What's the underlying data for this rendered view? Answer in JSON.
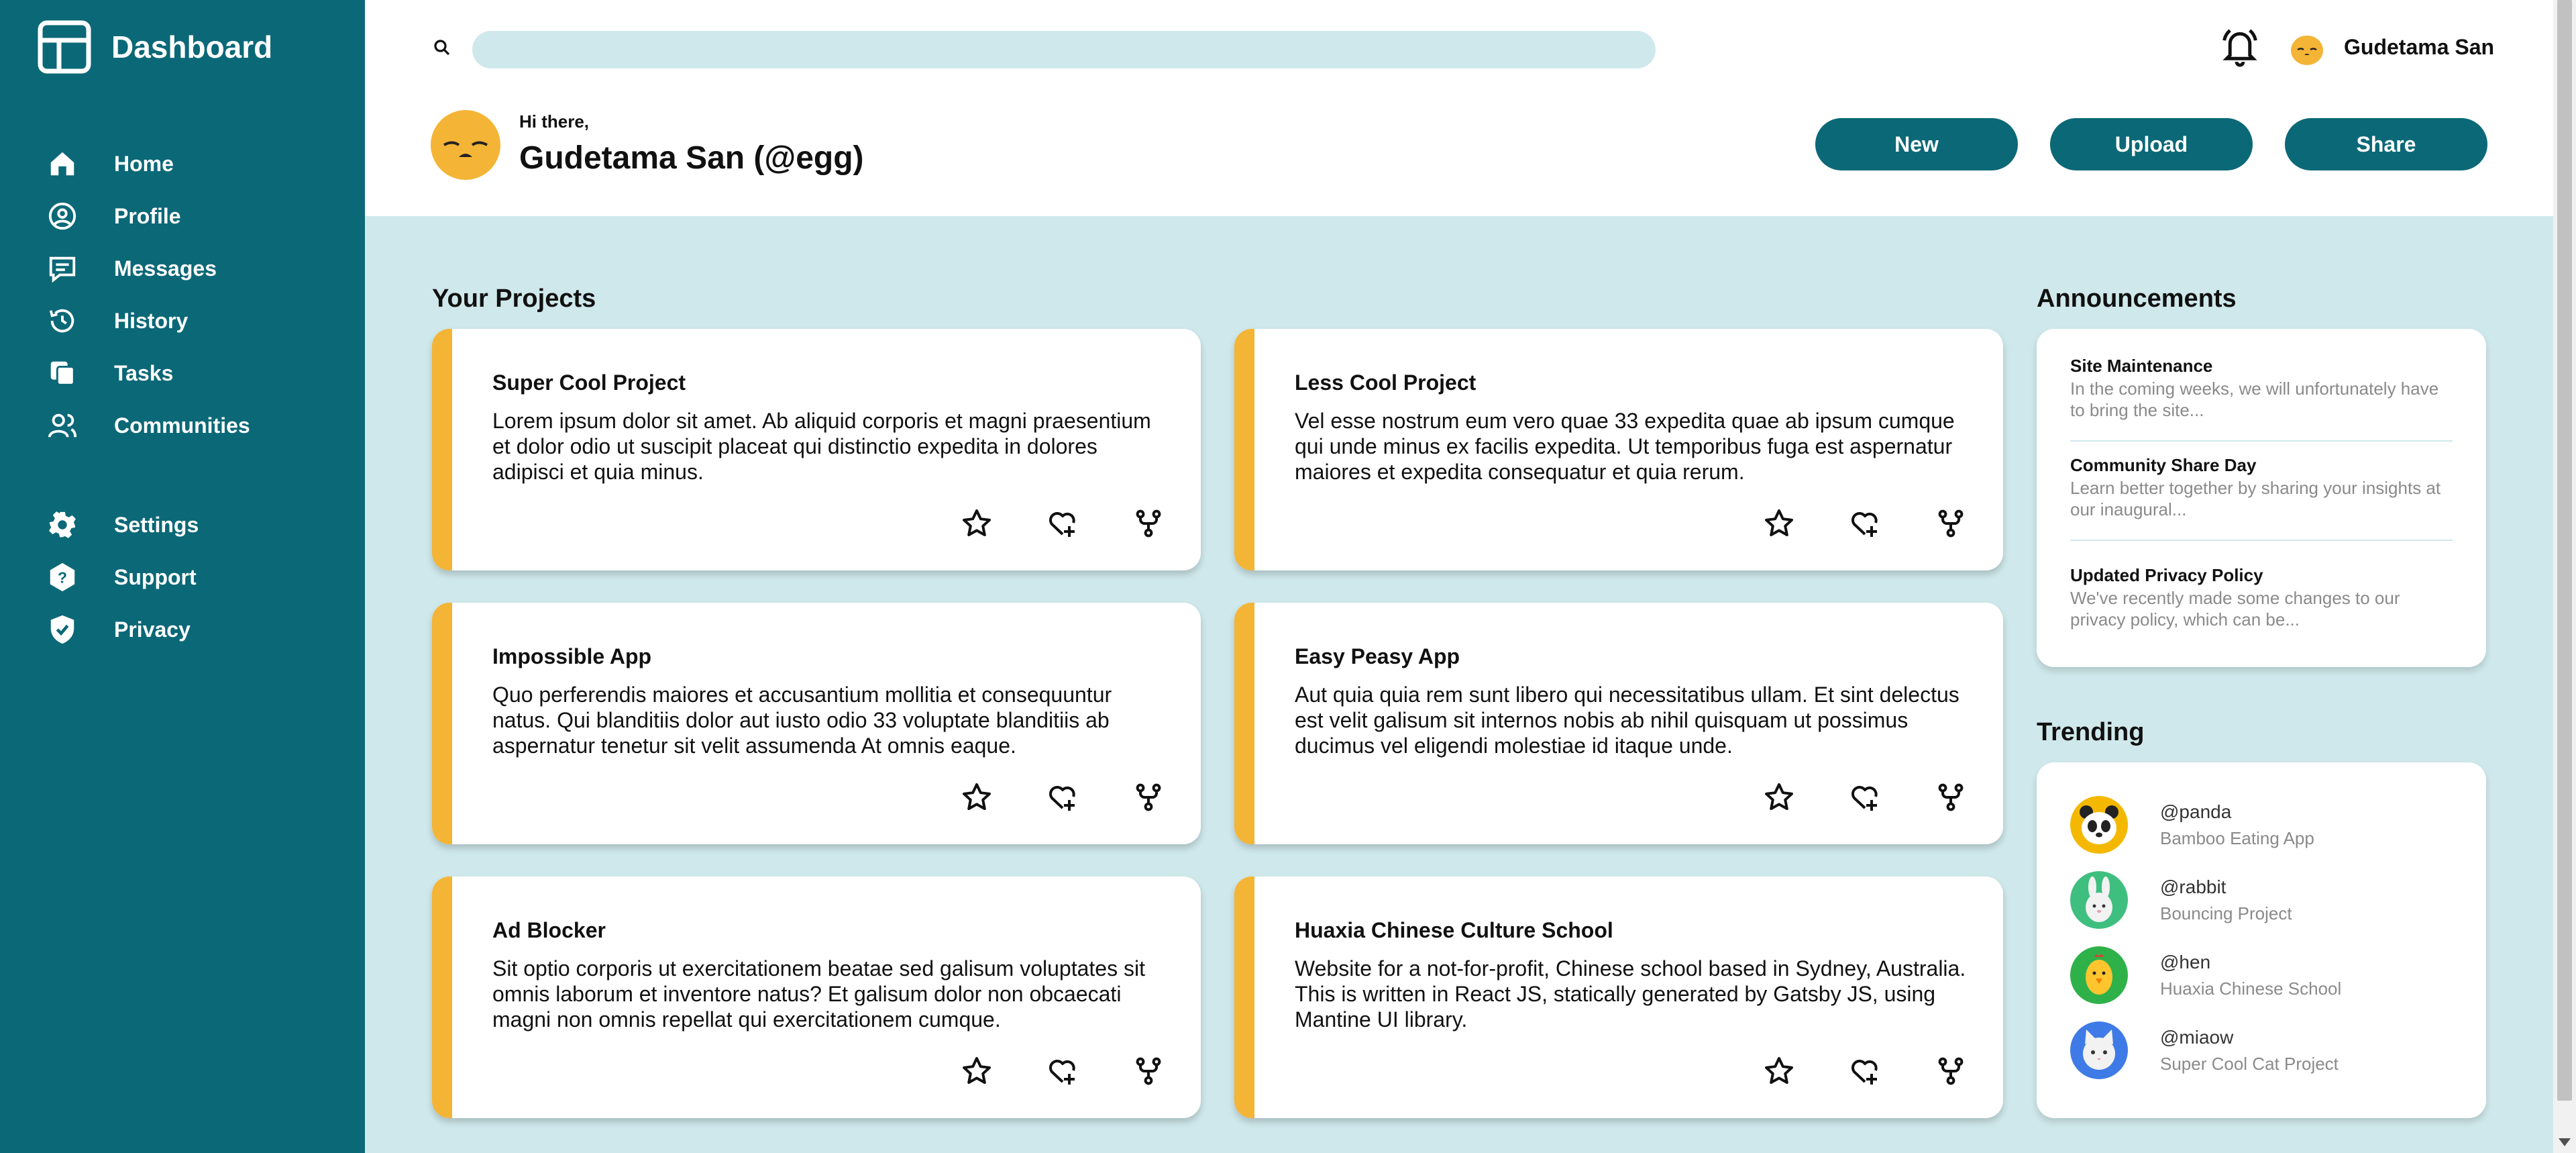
{
  "app": {
    "title": "Dashboard"
  },
  "colors": {
    "primary": "#0b6877",
    "background": "#cfe8eb",
    "accent": "#f4b436",
    "surface": "#ffffff"
  },
  "sidebar": {
    "main_items": [
      {
        "label": "Home",
        "icon": "home-icon"
      },
      {
        "label": "Profile",
        "icon": "user-circle-icon"
      },
      {
        "label": "Messages",
        "icon": "message-icon"
      },
      {
        "label": "History",
        "icon": "history-icon"
      },
      {
        "label": "Tasks",
        "icon": "tasks-icon"
      },
      {
        "label": "Communities",
        "icon": "users-icon"
      }
    ],
    "secondary_items": [
      {
        "label": "Settings",
        "icon": "gear-icon"
      },
      {
        "label": "Support",
        "icon": "help-icon"
      },
      {
        "label": "Privacy",
        "icon": "shield-icon"
      }
    ]
  },
  "header": {
    "search_placeholder": "",
    "user_name": "Gudetama San",
    "greeting": "Hi there,",
    "profile_name": "Gudetama San (@egg)",
    "buttons": {
      "new": "New",
      "upload": "Upload",
      "share": "Share"
    }
  },
  "projects": {
    "title": "Your Projects",
    "items": [
      {
        "title": "Super Cool Project",
        "description": "Lorem ipsum dolor sit amet. Ab aliquid corporis et magni praesentium et dolor odio ut suscipit placeat qui distinctio expedita in dolores adipisci et quia minus."
      },
      {
        "title": "Less Cool Project",
        "description": "Vel esse nostrum eum vero quae 33 expedita quae ab ipsum cumque qui unde minus ex facilis expedita. Ut temporibus fuga est aspernatur maiores et expedita consequatur et quia rerum."
      },
      {
        "title": "Impossible App",
        "description": "Quo perferendis maiores et accusantium mollitia et consequuntur natus. Qui blanditiis dolor aut iusto odio 33 voluptate blanditiis ab aspernatur tenetur sit velit assumenda At omnis eaque."
      },
      {
        "title": "Easy Peasy App",
        "description": "Aut quia quia rem sunt libero qui necessitatibus ullam. Et sint delectus est velit galisum sit internos nobis ab nihil quisquam ut possimus ducimus vel eligendi molestiae id itaque unde."
      },
      {
        "title": "Ad Blocker",
        "description": "Sit optio corporis ut exercitationem beatae sed galisum voluptates sit omnis laborum et inventore natus? Et galisum dolor non obcaecati magni non omnis repellat qui exercitationem cumque."
      },
      {
        "title": "Huaxia Chinese Culture School",
        "description": "Website for a not-for-profit, Chinese school based in Sydney, Australia. This is written in React JS, statically generated by Gatsby JS, using Mantine UI library."
      }
    ]
  },
  "announcements": {
    "title": "Announcements",
    "items": [
      {
        "title": "Site Maintenance",
        "text": "In the coming weeks, we will unfortunately have to bring the site..."
      },
      {
        "title": "Community Share Day",
        "text": "Learn better together by sharing your insights at our inaugural..."
      },
      {
        "title": "Updated Privacy Policy",
        "text": "We've recently made some changes to our privacy policy, which can be..."
      }
    ]
  },
  "trending": {
    "title": "Trending",
    "items": [
      {
        "handle": "@panda",
        "project": "Bamboo Eating App",
        "avatar_color": "#f4b800"
      },
      {
        "handle": "@rabbit",
        "project": "Bouncing Project",
        "avatar_color": "#3fbf7f"
      },
      {
        "handle": "@hen",
        "project": "Huaxia Chinese School",
        "avatar_color": "#2fb14a"
      },
      {
        "handle": "@miaow",
        "project": "Super Cool Cat Project",
        "avatar_color": "#3f7be6"
      }
    ]
  }
}
